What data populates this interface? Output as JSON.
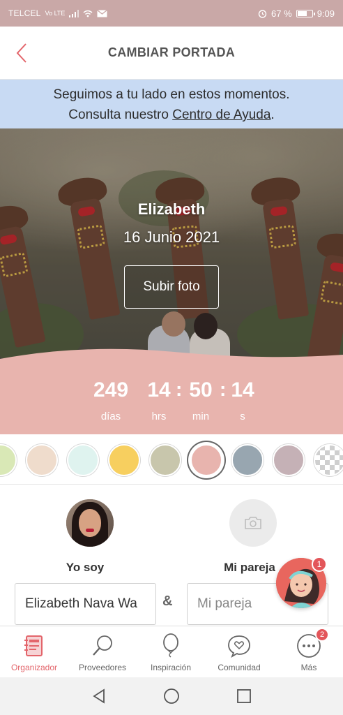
{
  "status_bar": {
    "carrier": "TELCEL",
    "network": "Vo LTE",
    "battery_percent": "67 %",
    "battery_level": 0.67,
    "time": "9:09"
  },
  "header": {
    "title": "CAMBIAR PORTADA"
  },
  "banner": {
    "line1": "Seguimos a tu lado en estos momentos.",
    "line2_prefix": "Consulta nuestro ",
    "link": "Centro de Ayuda",
    "line2_suffix": ".",
    "background": "#c8daf3"
  },
  "cover": {
    "name": "Elizabeth",
    "date": "16 Junio 2021",
    "upload_label": "Subir foto"
  },
  "countdown": {
    "color": "#e8b4ae",
    "days": "249",
    "hours": "14",
    "minutes": "50",
    "seconds": "14",
    "separator": ":",
    "days_label": "días",
    "hours_label": "hrs",
    "minutes_label": "min",
    "seconds_label": "s"
  },
  "swatches": [
    {
      "color": "#d9e8b6",
      "selected": false
    },
    {
      "color": "#efdccc",
      "selected": false
    },
    {
      "color": "#dff3ef",
      "selected": false
    },
    {
      "color": "#f7cf5f",
      "selected": false
    },
    {
      "color": "#c8c6ac",
      "selected": false
    },
    {
      "color": "#e8b4ae",
      "selected": true
    },
    {
      "color": "#98a6b0",
      "selected": false
    },
    {
      "color": "#c5b1b6",
      "selected": false
    },
    {
      "color": "checkerboard",
      "selected": false
    }
  ],
  "profiles": {
    "me_label": "Yo soy",
    "partner_label": "Mi pareja",
    "me_name": "Elizabeth Nava Wa",
    "partner_placeholder": "Mi pareja",
    "ampersand": "&"
  },
  "chat": {
    "badge": "1"
  },
  "bottom_nav": {
    "items": [
      {
        "label": "Organizador",
        "icon": "organizer-icon",
        "active": true
      },
      {
        "label": "Proveedores",
        "icon": "search-icon",
        "active": false
      },
      {
        "label": "Inspiración",
        "icon": "balloon-icon",
        "active": false
      },
      {
        "label": "Comunidad",
        "icon": "community-heart-icon",
        "active": false
      },
      {
        "label": "Más",
        "icon": "more-icon",
        "active": false,
        "badge": "2"
      }
    ]
  },
  "colors": {
    "accent": "#e3656b",
    "status_bar": "#c9a8a7"
  }
}
